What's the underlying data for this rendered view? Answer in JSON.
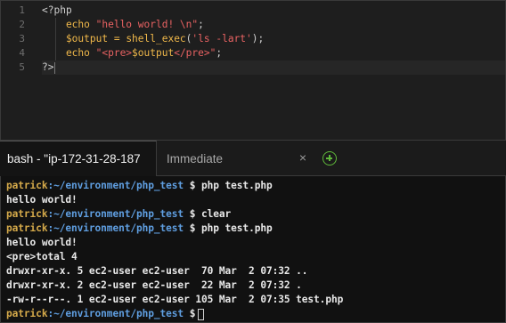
{
  "editor": {
    "line_numbers": [
      "1",
      "2",
      "3",
      "4",
      "5"
    ],
    "lines": [
      [
        {
          "t": "<?php",
          "c": "plain"
        }
      ],
      [
        {
          "t": "    echo ",
          "c": "kw"
        },
        {
          "t": "\"hello world! \\n\"",
          "c": "str"
        },
        {
          "t": ";",
          "c": "plain"
        }
      ],
      [
        {
          "t": "    $output",
          "c": "var"
        },
        {
          "t": " = ",
          "c": "op"
        },
        {
          "t": "shell_exec",
          "c": "kw"
        },
        {
          "t": "(",
          "c": "plain"
        },
        {
          "t": "'ls -lart'",
          "c": "str"
        },
        {
          "t": ");",
          "c": "plain"
        }
      ],
      [
        {
          "t": "    echo ",
          "c": "kw"
        },
        {
          "t": "\"<pre>",
          "c": "str"
        },
        {
          "t": "$output",
          "c": "var"
        },
        {
          "t": "</pre>\"",
          "c": "str"
        },
        {
          "t": ";",
          "c": "plain"
        }
      ],
      [
        {
          "t": "?>",
          "c": "plain"
        }
      ]
    ]
  },
  "tabs": {
    "terminal_tab": "bash - \"ip-172-31-28-187.",
    "immediate_tab": "Immediate",
    "close_glyph": "×",
    "add_glyph": "+"
  },
  "terminal": {
    "user": "patrick",
    "path": ":~/environment/php_test",
    "lines": [
      {
        "type": "prompt",
        "cmd": " $ php test.php"
      },
      {
        "type": "out",
        "text": "hello world!"
      },
      {
        "type": "prompt",
        "cmd": " $ clear"
      },
      {
        "type": "prompt",
        "cmd": " $ php test.php"
      },
      {
        "type": "out",
        "text": "hello world!"
      },
      {
        "type": "out",
        "text": "<pre>total 4"
      },
      {
        "type": "out",
        "text": "drwxr-xr-x. 5 ec2-user ec2-user  70 Mar  2 07:32 .."
      },
      {
        "type": "out",
        "text": "drwxr-xr-x. 2 ec2-user ec2-user  22 Mar  2 07:32 ."
      },
      {
        "type": "out",
        "text": "-rw-r--r--. 1 ec2-user ec2-user 105 Mar  2 07:35 test.php"
      },
      {
        "type": "prompt",
        "cmd": " $"
      }
    ]
  }
}
